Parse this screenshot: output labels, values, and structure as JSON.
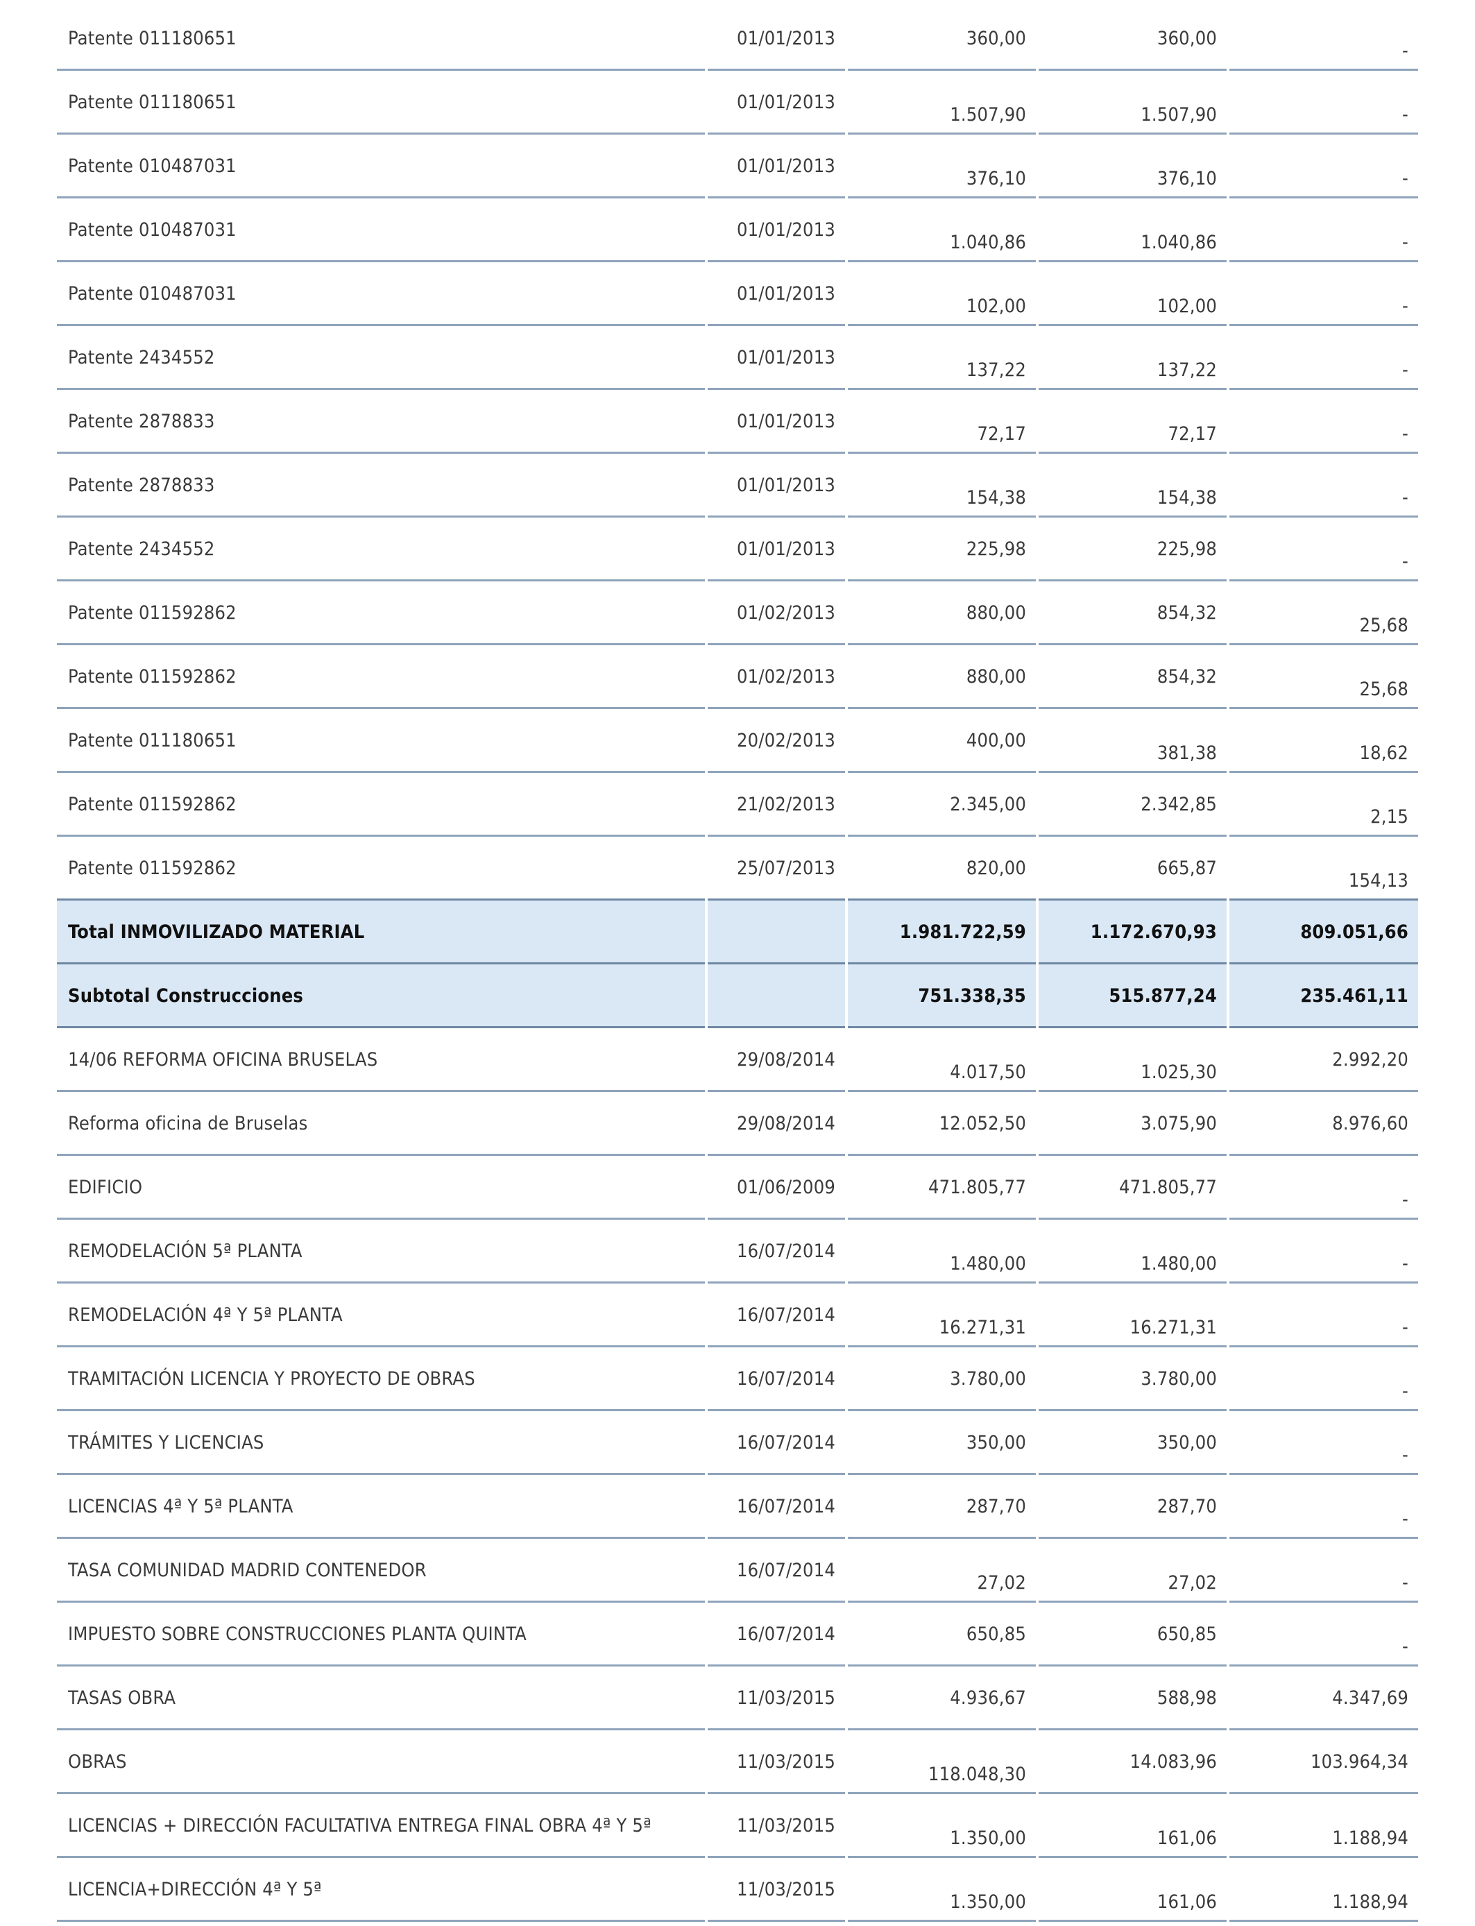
{
  "rows": [
    {
      "concept": "Patente 011180651",
      "date": "01/01/2013",
      "v1": "360,00",
      "v2": "360,00",
      "v3": "-",
      "pos": [
        1,
        1,
        0
      ]
    },
    {
      "concept": "Patente 011180651",
      "date": "01/01/2013",
      "v1": "1.507,90",
      "v2": "1.507,90",
      "v3": "-",
      "pos": [
        0,
        0,
        0
      ]
    },
    {
      "concept": "Patente 010487031",
      "date": "01/01/2013",
      "v1": "376,10",
      "v2": "376,10",
      "v3": "-",
      "pos": [
        0,
        0,
        0
      ]
    },
    {
      "concept": "Patente 010487031",
      "date": "01/01/2013",
      "v1": "1.040,86",
      "v2": "1.040,86",
      "v3": "-",
      "pos": [
        0,
        0,
        0
      ]
    },
    {
      "concept": "Patente 010487031",
      "date": "01/01/2013",
      "v1": "102,00",
      "v2": "102,00",
      "v3": "-",
      "pos": [
        0,
        0,
        0
      ]
    },
    {
      "concept": "Patente 2434552",
      "date": "01/01/2013",
      "v1": "137,22",
      "v2": "137,22",
      "v3": "-",
      "pos": [
        0,
        0,
        0
      ]
    },
    {
      "concept": "Patente 2878833",
      "date": "01/01/2013",
      "v1": "72,17",
      "v2": "72,17",
      "v3": "-",
      "pos": [
        0,
        0,
        0
      ]
    },
    {
      "concept": "Patente 2878833",
      "date": "01/01/2013",
      "v1": "154,38",
      "v2": "154,38",
      "v3": "-",
      "pos": [
        0,
        0,
        0
      ]
    },
    {
      "concept": "Patente 2434552",
      "date": "01/01/2013",
      "v1": "225,98",
      "v2": "225,98",
      "v3": "-",
      "pos": [
        1,
        1,
        0
      ]
    },
    {
      "concept": "Patente 011592862",
      "date": "01/02/2013",
      "v1": "880,00",
      "v2": "854,32",
      "v3": "25,68",
      "pos": [
        1,
        1,
        0
      ]
    },
    {
      "concept": "Patente 011592862",
      "date": "01/02/2013",
      "v1": "880,00",
      "v2": "854,32",
      "v3": "25,68",
      "pos": [
        1,
        1,
        0
      ]
    },
    {
      "concept": "Patente 011180651",
      "date": "20/02/2013",
      "v1": "400,00",
      "v2": "381,38",
      "v3": "18,62",
      "pos": [
        1,
        0,
        0
      ]
    },
    {
      "concept": "Patente 011592862",
      "date": "21/02/2013",
      "v1": "2.345,00",
      "v2": "2.342,85",
      "v3": "2,15",
      "pos": [
        1,
        1,
        0
      ]
    },
    {
      "concept": "Patente 011592862",
      "date": "25/07/2013",
      "v1": "820,00",
      "v2": "665,87",
      "v3": "154,13",
      "pos": [
        1,
        1,
        0
      ]
    },
    {
      "concept": "Total INMOVILIZADO MATERIAL",
      "date": "",
      "v1": "1.981.722,59",
      "v2": "1.172.670,93",
      "v3": "809.051,66",
      "total": true,
      "pos": [
        1,
        1,
        1
      ]
    },
    {
      "concept": "Subtotal Construcciones",
      "date": "",
      "v1": "751.338,35",
      "v2": "515.877,24",
      "v3": "235.461,11",
      "total": true,
      "pos": [
        1,
        1,
        1
      ]
    },
    {
      "concept": "14/06 REFORMA OFICINA BRUSELAS",
      "date": "29/08/2014",
      "v1": "4.017,50",
      "v2": "1.025,30",
      "v3": "2.992,20",
      "pos": [
        0,
        0,
        1
      ]
    },
    {
      "concept": "Reforma oficina de Bruselas",
      "date": "29/08/2014",
      "v1": "12.052,50",
      "v2": "3.075,90",
      "v3": "8.976,60",
      "pos": [
        1,
        1,
        1
      ]
    },
    {
      "concept": "EDIFICIO",
      "date": "01/06/2009",
      "v1": "471.805,77",
      "v2": "471.805,77",
      "v3": "-",
      "pos": [
        1,
        1,
        0
      ]
    },
    {
      "concept": "REMODELACIÓN 5ª PLANTA",
      "date": "16/07/2014",
      "v1": "1.480,00",
      "v2": "1.480,00",
      "v3": "-",
      "pos": [
        0,
        0,
        0
      ]
    },
    {
      "concept": "REMODELACIÓN 4ª Y 5ª PLANTA",
      "date": "16/07/2014",
      "v1": "16.271,31",
      "v2": "16.271,31",
      "v3": "-",
      "pos": [
        0,
        0,
        0
      ]
    },
    {
      "concept": "TRAMITACIÓN LICENCIA Y PROYECTO DE OBRAS",
      "date": "16/07/2014",
      "v1": "3.780,00",
      "v2": "3.780,00",
      "v3": "-",
      "pos": [
        1,
        1,
        0
      ]
    },
    {
      "concept": "TRÁMITES Y LICENCIAS",
      "date": "16/07/2014",
      "v1": "350,00",
      "v2": "350,00",
      "v3": "-",
      "pos": [
        1,
        1,
        0
      ]
    },
    {
      "concept": "LICENCIAS 4ª Y 5ª PLANTA",
      "date": "16/07/2014",
      "v1": "287,70",
      "v2": "287,70",
      "v3": "-",
      "pos": [
        1,
        1,
        0
      ]
    },
    {
      "concept": "TASA COMUNIDAD MADRID CONTENEDOR",
      "date": "16/07/2014",
      "v1": "27,02",
      "v2": "27,02",
      "v3": "-",
      "pos": [
        0,
        0,
        0
      ]
    },
    {
      "concept": "IMPUESTO SOBRE CONSTRUCCIONES PLANTA QUINTA",
      "date": "16/07/2014",
      "v1": "650,85",
      "v2": "650,85",
      "v3": "-",
      "pos": [
        1,
        1,
        0
      ]
    },
    {
      "concept": "TASAS OBRA",
      "date": "11/03/2015",
      "v1": "4.936,67",
      "v2": "588,98",
      "v3": "4.347,69",
      "pos": [
        1,
        1,
        1
      ]
    },
    {
      "concept": "OBRAS",
      "date": "11/03/2015",
      "v1": "118.048,30",
      "v2": "14.083,96",
      "v3": "103.964,34",
      "pos": [
        0,
        1,
        1
      ]
    },
    {
      "concept": "LICENCIAS + DIRECCIÓN FACULTATIVA ENTREGA FINAL OBRA 4ª Y 5ª",
      "date": "11/03/2015",
      "v1": "1.350,00",
      "v2": "161,06",
      "v3": "1.188,94",
      "pos": [
        0,
        0,
        0
      ]
    },
    {
      "concept": "LICENCIA+DIRECCIÓN 4ª Y 5ª",
      "date": "11/03/2015",
      "v1": "1.350,00",
      "v2": "161,06",
      "v3": "1.188,94",
      "pos": [
        0,
        0,
        0
      ]
    }
  ]
}
